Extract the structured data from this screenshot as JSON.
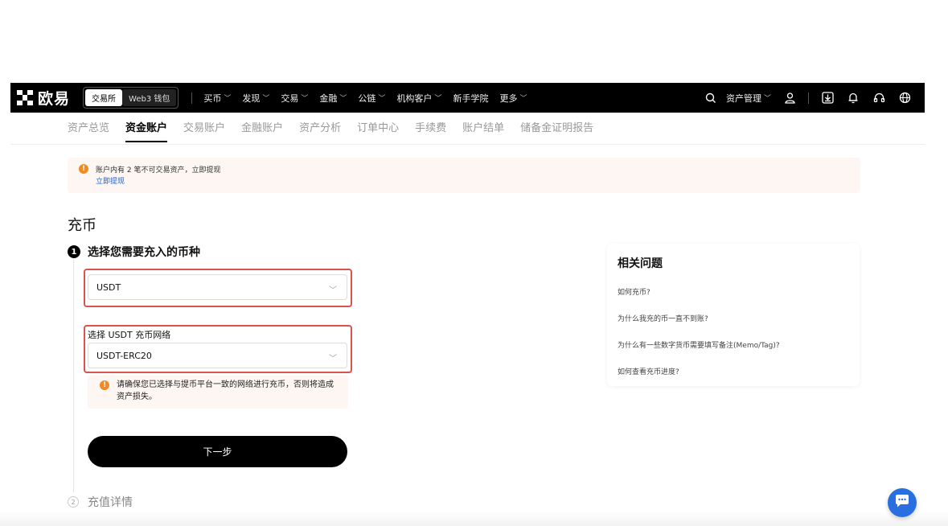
{
  "brand": {
    "name": "欧易"
  },
  "mode_tabs": [
    {
      "label": "交易所",
      "active": true
    },
    {
      "label": "Web3 钱包",
      "active": false
    }
  ],
  "nav": {
    "items": [
      {
        "label": "买币",
        "dropdown": true
      },
      {
        "label": "发现",
        "dropdown": true
      },
      {
        "label": "交易",
        "dropdown": true
      },
      {
        "label": "金融",
        "dropdown": true
      },
      {
        "label": "公链",
        "dropdown": true
      },
      {
        "label": "机构客户",
        "dropdown": true
      },
      {
        "label": "新手学院",
        "dropdown": false
      },
      {
        "label": "更多",
        "dropdown": true
      }
    ],
    "asset_menu": "资产管理",
    "chevron": "﹀",
    "icons": [
      "search-icon",
      "user-icon",
      "download-icon",
      "bell-icon",
      "headset-icon",
      "globe-icon"
    ]
  },
  "subtabs": [
    {
      "label": "资产总览",
      "active": false
    },
    {
      "label": "资金账户",
      "active": true
    },
    {
      "label": "交易账户",
      "active": false
    },
    {
      "label": "金融账户",
      "active": false
    },
    {
      "label": "资产分析",
      "active": false
    },
    {
      "label": "订单中心",
      "active": false
    },
    {
      "label": "手续费",
      "active": false
    },
    {
      "label": "账户结单",
      "active": false
    },
    {
      "label": "储备金证明报告",
      "active": false
    }
  ],
  "notice": {
    "icon_text": "!",
    "message": "账户内有 2 笔不可交易资产，立即提现",
    "link": "立即提现"
  },
  "page": {
    "title": "充币"
  },
  "step1": {
    "number": "1",
    "title": "选择您需要充入的币种",
    "coin_value": "USDT",
    "network_label": "选择 USDT 充币网络",
    "network_value": "USDT-ERC20",
    "warning": "请确保您已选择与提币平台一致的网络进行充币，否则将造成资产损失。",
    "next_button": "下一步"
  },
  "step2": {
    "number": "2",
    "title": "充值详情"
  },
  "faq": {
    "title": "相关问题",
    "questions": [
      "如何充币?",
      "为什么我充的币一直不到账?",
      "为什么有一些数字货币需要填写备注(Memo/Tag)?",
      "如何查看充币进度?"
    ]
  },
  "colors": {
    "accent": "#2a6fe0",
    "highlight": "#d9534f",
    "warning": "#f08a24"
  }
}
